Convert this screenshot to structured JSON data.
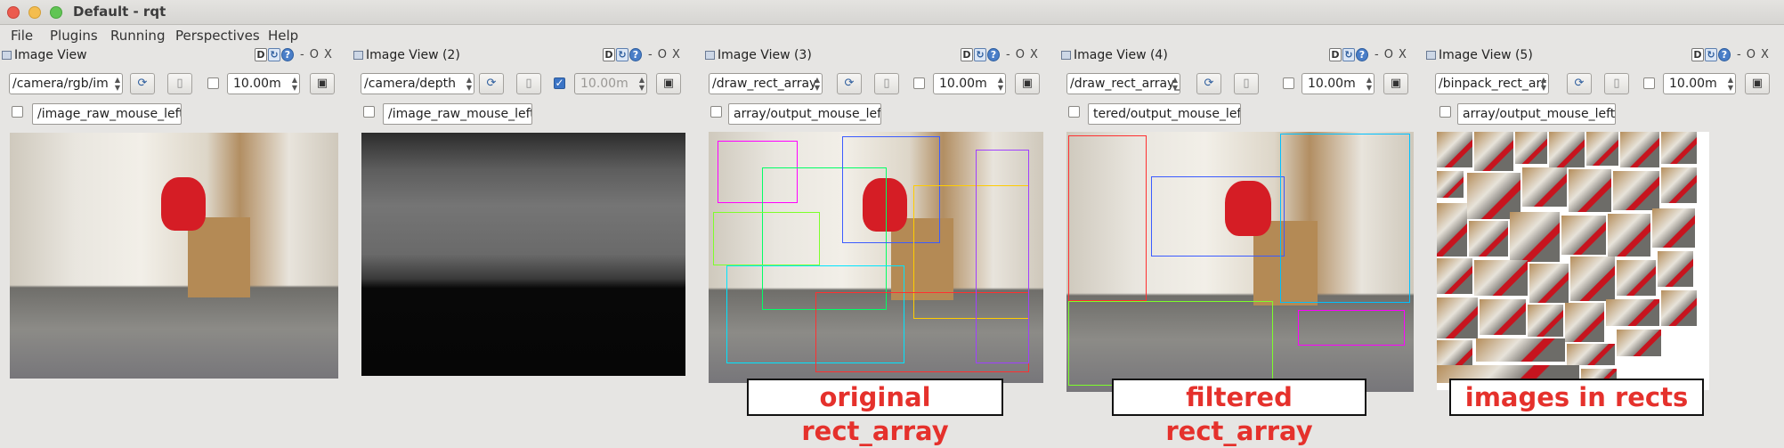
{
  "window": {
    "title": "Default - rqt"
  },
  "menubar": [
    "File",
    "Plugins",
    "Running",
    "Perspectives",
    "Help"
  ],
  "panels": [
    {
      "label": "Image View",
      "topic": "/camera/rgb/im",
      "sync_checked": false,
      "rate": "10.00m",
      "rate_enabled": true,
      "mouse_checked": false,
      "mouse_topic": "/image_raw_mouse_left"
    },
    {
      "label": "Image View (2)",
      "topic": "/camera/depth",
      "sync_checked": true,
      "rate": "10.00m",
      "rate_enabled": false,
      "mouse_checked": false,
      "mouse_topic": "/image_raw_mouse_left"
    },
    {
      "label": "Image View (3)",
      "topic": "/draw_rect_array",
      "sync_checked": false,
      "rate": "10.00m",
      "rate_enabled": true,
      "mouse_checked": false,
      "mouse_topic": "array/output_mouse_left"
    },
    {
      "label": "Image View (4)",
      "topic": "/draw_rect_array_f",
      "sync_checked": false,
      "rate": "10.00m",
      "rate_enabled": true,
      "mouse_checked": false,
      "mouse_topic": "tered/output_mouse_left"
    },
    {
      "label": "Image View (5)",
      "topic": "/binpack_rect_arr",
      "sync_checked": false,
      "rate": "10.00m",
      "rate_enabled": true,
      "mouse_checked": false,
      "mouse_topic": "array/output_mouse_left"
    }
  ],
  "panel_controls": {
    "d": "D",
    "dash": "-",
    "o": "O",
    "x": "X"
  },
  "captions": [
    "original rect_array",
    "filtered rect_array",
    "images in rects"
  ],
  "colors": {
    "caption_text": "#e5312c",
    "window_bg": "#e6e5e3"
  }
}
